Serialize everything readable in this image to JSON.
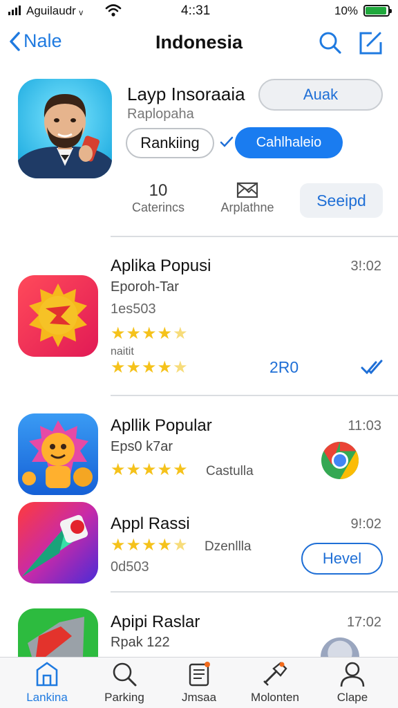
{
  "status_bar": {
    "carrier": "Aguilaudr ᵥ",
    "time": "4::31",
    "battery": "10%",
    "battery_level": 0.95
  },
  "nav": {
    "back_label": "Nale",
    "title": "Indonesia"
  },
  "featured": {
    "title": "Layp Insoraaia",
    "subtitle": "Raplopaha",
    "get_button": "Auak",
    "ranking_button": "Rankiing",
    "primary_button": "Cahlhaleio",
    "stat_categories": {
      "value": "10",
      "label": "Caterincs"
    },
    "stat_apps": {
      "label": "Arplathne"
    },
    "see_all_button": "Seeipd"
  },
  "apps": [
    {
      "name": "Aplika Popusi",
      "developer": "Eporoh-Tar",
      "code": "1es503",
      "extra": "naitit",
      "time": "3!:02",
      "rating_1": 4,
      "rating_2": 4,
      "count": "2R0"
    },
    {
      "name": "Apllik Popular",
      "developer": "Eps0 k7ar",
      "label": "Castulla",
      "time": "11:03",
      "rating": 5
    },
    {
      "name": "Appl Rassi",
      "code": "0d503",
      "label": "Dzenllla",
      "time": "9!:02",
      "rating": 4,
      "button": "Hevel"
    },
    {
      "name": "Apipi Raslar",
      "developer": "Rpak 122",
      "time": "17:02"
    }
  ],
  "tab_bar": [
    {
      "label": "Lankina",
      "icon": "home-icon",
      "active": true
    },
    {
      "label": "Parking",
      "icon": "search-icon",
      "active": false
    },
    {
      "label": "Jmsaa",
      "icon": "news-icon",
      "active": false
    },
    {
      "label": "Molonten",
      "icon": "tools-icon",
      "active": false
    },
    {
      "label": "Clape",
      "icon": "profile-icon",
      "active": false
    }
  ],
  "colors": {
    "accent": "#1f7ae0",
    "primary_button": "#1a7cf0",
    "star": "#f5c21b",
    "battery": "#1fa83c"
  }
}
